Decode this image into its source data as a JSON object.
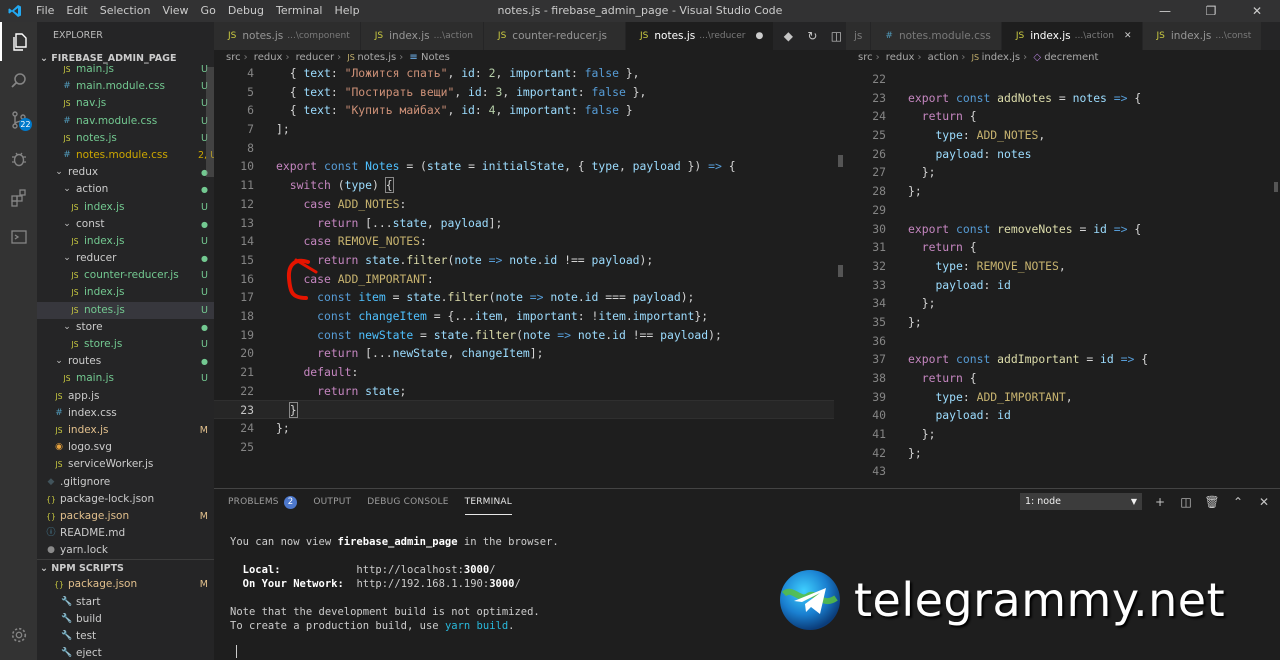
{
  "titlebar": {
    "menu": [
      "File",
      "Edit",
      "Selection",
      "View",
      "Go",
      "Debug",
      "Terminal",
      "Help"
    ],
    "title": "notes.js - firebase_admin_page - Visual Studio Code"
  },
  "activity": {
    "icons": [
      "files-icon",
      "search-icon",
      "source-control-icon",
      "debug-icon",
      "extensions-icon",
      "remote-icon"
    ],
    "scm_badge": "22"
  },
  "sidebar": {
    "header": "EXPLORER",
    "project": "FIREBASE_ADMIN_PAGE",
    "npm_section": "NPM SCRIPTS",
    "rows": [
      {
        "label": "main.js",
        "status": "U",
        "indent": 2,
        "type": "js"
      },
      {
        "label": "main.module.css",
        "status": "U",
        "indent": 2,
        "type": "css"
      },
      {
        "label": "nav.js",
        "status": "U",
        "indent": 2,
        "type": "js"
      },
      {
        "label": "nav.module.css",
        "status": "U",
        "indent": 2,
        "type": "css"
      },
      {
        "label": "notes.js",
        "status": "U",
        "indent": 2,
        "type": "js"
      },
      {
        "label": "notes.module.css",
        "status": "2, U",
        "indent": 2,
        "type": "css",
        "warn": true
      },
      {
        "label": "redux",
        "status": "dot",
        "indent": 1,
        "type": "folder"
      },
      {
        "label": "action",
        "status": "dot",
        "indent": 2,
        "type": "folder"
      },
      {
        "label": "index.js",
        "status": "U",
        "indent": 3,
        "type": "js"
      },
      {
        "label": "const",
        "status": "dot",
        "indent": 2,
        "type": "folder"
      },
      {
        "label": "index.js",
        "status": "U",
        "indent": 3,
        "type": "js"
      },
      {
        "label": "reducer",
        "status": "dot",
        "indent": 2,
        "type": "folder"
      },
      {
        "label": "counter-reducer.js",
        "status": "U",
        "indent": 3,
        "type": "js"
      },
      {
        "label": "index.js",
        "status": "U",
        "indent": 3,
        "type": "js"
      },
      {
        "label": "notes.js",
        "status": "U",
        "indent": 3,
        "type": "js",
        "selected": true
      },
      {
        "label": "store",
        "status": "dot",
        "indent": 2,
        "type": "folder"
      },
      {
        "label": "store.js",
        "status": "U",
        "indent": 3,
        "type": "js"
      },
      {
        "label": "routes",
        "status": "dot",
        "indent": 1,
        "type": "folder"
      },
      {
        "label": "main.js",
        "status": "U",
        "indent": 2,
        "type": "js"
      },
      {
        "label": "app.js",
        "status": "",
        "indent": 1,
        "type": "js"
      },
      {
        "label": "index.css",
        "status": "",
        "indent": 1,
        "type": "css"
      },
      {
        "label": "index.js",
        "status": "M",
        "indent": 1,
        "type": "js",
        "modified": true
      },
      {
        "label": "logo.svg",
        "status": "",
        "indent": 1,
        "type": "svg"
      },
      {
        "label": "serviceWorker.js",
        "status": "",
        "indent": 1,
        "type": "js"
      },
      {
        "label": ".gitignore",
        "status": "",
        "indent": 0,
        "type": "git"
      },
      {
        "label": "package-lock.json",
        "status": "",
        "indent": 0,
        "type": "json"
      },
      {
        "label": "package.json",
        "status": "M",
        "indent": 0,
        "type": "json",
        "modified": true
      },
      {
        "label": "README.md",
        "status": "",
        "indent": 0,
        "type": "md"
      },
      {
        "label": "yarn.lock",
        "status": "",
        "indent": 0,
        "type": "lock"
      }
    ],
    "npm_rows": [
      {
        "label": "package.json",
        "status": "M",
        "indent": 1,
        "type": "json",
        "modified": true
      },
      {
        "label": "start",
        "status": "",
        "indent": 2,
        "type": "wrench"
      },
      {
        "label": "build",
        "status": "",
        "indent": 2,
        "type": "wrench"
      },
      {
        "label": "test",
        "status": "",
        "indent": 2,
        "type": "wrench"
      },
      {
        "label": "eject",
        "status": "",
        "indent": 2,
        "type": "wrench"
      }
    ]
  },
  "left_tabs": [
    {
      "label": "notes.js",
      "desc": "...\\component",
      "icon": "js"
    },
    {
      "label": "index.js",
      "desc": "...\\action",
      "icon": "js"
    },
    {
      "label": "counter-reducer.js",
      "desc": "",
      "icon": "js"
    },
    {
      "label": "notes.js",
      "desc": "...\\reducer",
      "icon": "js",
      "active": true,
      "dirty": true
    }
  ],
  "right_tabs": [
    {
      "label": "js",
      "desc": "",
      "icon": ""
    },
    {
      "label": "notes.module.css",
      "desc": "",
      "icon": "css"
    },
    {
      "label": "index.js",
      "desc": "...\\action",
      "icon": "js",
      "active": true,
      "close": true
    },
    {
      "label": "index.js",
      "desc": "...\\const",
      "icon": "js"
    }
  ],
  "left_crumbs": [
    "src",
    "redux",
    "reducer",
    "notes.js",
    "Notes"
  ],
  "right_crumbs": [
    "src",
    "redux",
    "action",
    "index.js",
    "decrement"
  ],
  "panel": {
    "tabs": [
      "PROBLEMS",
      "OUTPUT",
      "DEBUG CONSOLE",
      "TERMINAL"
    ],
    "problems_count": "2",
    "terminal_select": "1: node",
    "lines": {
      "l1a": "You can now view ",
      "l1b": "firebase_admin_page",
      "l1c": " in the browser.",
      "local_label": "  Local:",
      "local_url_a": "            http://localhost:",
      "local_url_b": "3000",
      "local_url_c": "/",
      "net_label": "  On Your Network:",
      "net_url_a": "  http://192.168.1.190:",
      "net_url_b": "3000",
      "net_url_c": "/",
      "n1": "Note that the development build is not optimized.",
      "n2a": "To create a production build, use ",
      "n2b": "yarn build",
      "n2c": "."
    }
  },
  "watermark": "telegrammy.net",
  "colors": {
    "accent": "#007acc",
    "untracked": "#73c991",
    "modified": "#e2c08d",
    "annotation_red": "#e51400"
  }
}
